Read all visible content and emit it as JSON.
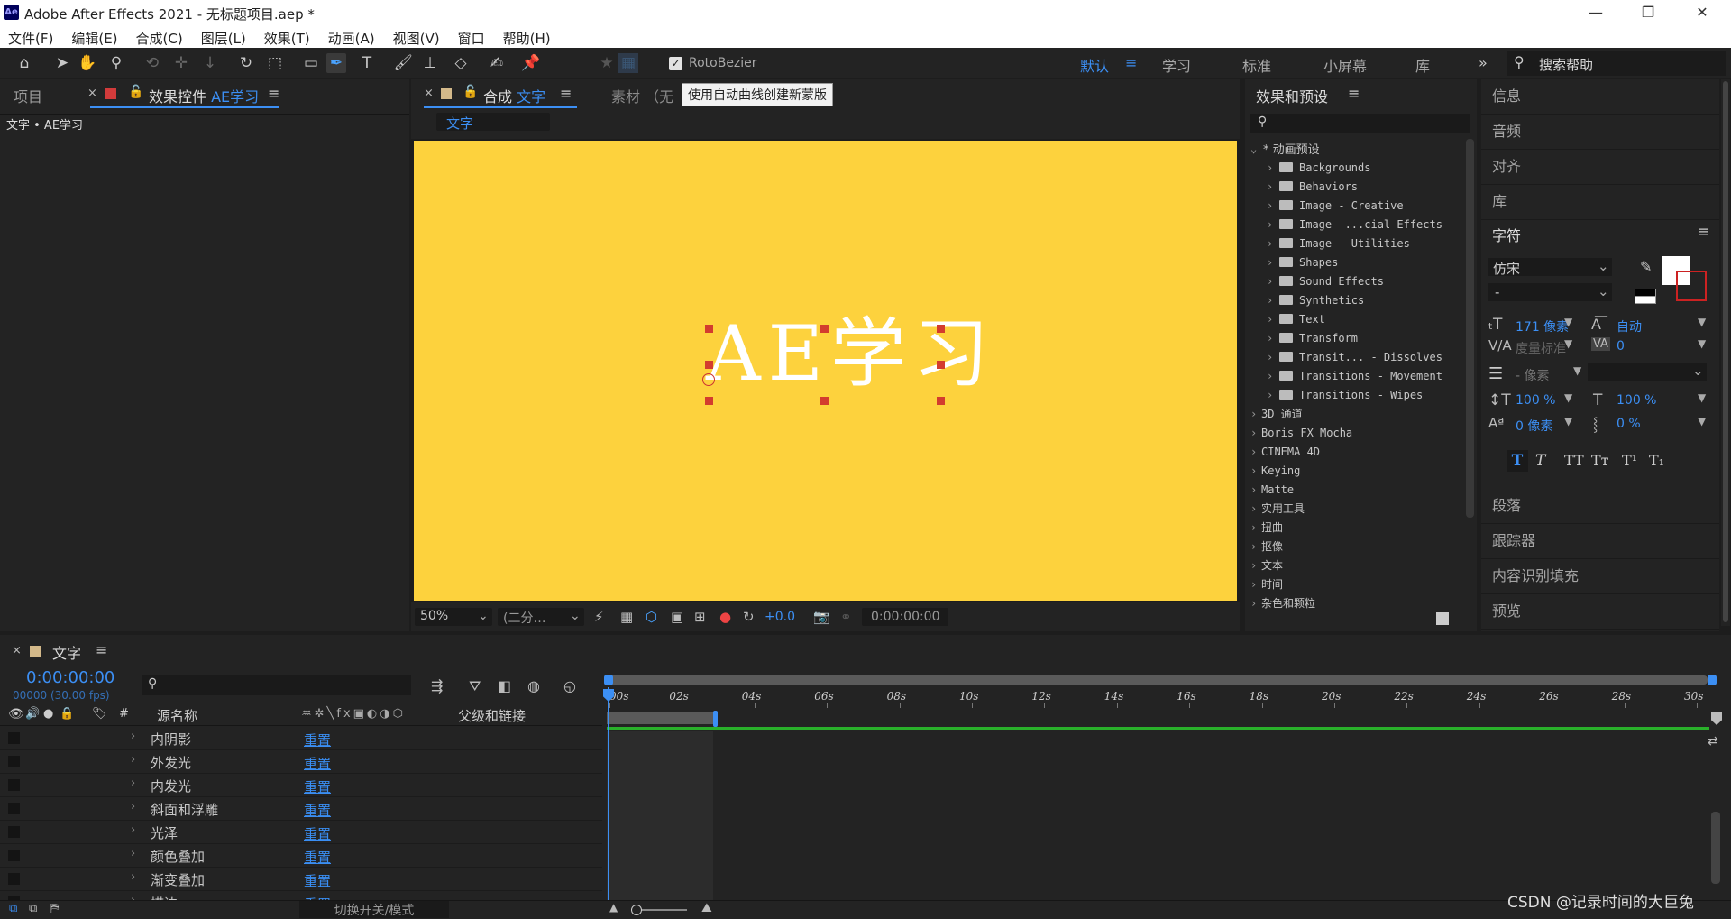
{
  "window": {
    "title": "Adobe After Effects 2021 - 无标题项目.aep *",
    "logo_text": "Ae"
  },
  "menu": [
    "文件(F)",
    "编辑(E)",
    "合成(C)",
    "图层(L)",
    "效果(T)",
    "动画(A)",
    "视图(V)",
    "窗口",
    "帮助(H)"
  ],
  "toolbar": {
    "rotobezier_label": "RotoBezier",
    "workspaces": [
      "默认",
      "学习",
      "标准",
      "小屏幕",
      "库"
    ],
    "search_placeholder": "搜索帮助"
  },
  "tooltip": "使用自动曲线创建新蒙版",
  "left_panel": {
    "tab_project": "项目",
    "tab_effects_prefix": "效果控件",
    "tab_effects_layer": "AE学习",
    "breadcrumb": "文字 • AE学习"
  },
  "comp_panel": {
    "tab_prefix": "合成",
    "tab_name": "文字",
    "footage_tab": "素材 （无",
    "subtab": "文字",
    "canvas_text": "AE学习",
    "canvas_bg": "#fdd23d",
    "zoom": "50%",
    "resolution": "(二分…",
    "exposure": "+0.0",
    "timecode": "0:00:00:00"
  },
  "effects_panel": {
    "title": "效果和预设",
    "presets_root": "* 动画预设",
    "preset_folders": [
      "Backgrounds",
      "Behaviors",
      "Image - Creative",
      "Image -...cial Effects",
      "Image - Utilities",
      "Shapes",
      "Sound Effects",
      "Synthetics",
      "Text",
      "Transform",
      "Transit... - Dissolves",
      "Transitions - Movement",
      "Transitions - Wipes"
    ],
    "categories": [
      "3D 通道",
      "Boris FX Mocha",
      "CINEMA 4D",
      "Keying",
      "Matte",
      "实用工具",
      "扭曲",
      "抠像",
      "文本",
      "时间",
      "杂色和颗粒"
    ]
  },
  "right_panel": {
    "items_top": [
      "信息",
      "音频",
      "对齐",
      "库"
    ],
    "character_title": "字符",
    "font_name": "仿宋",
    "font_style": "-",
    "font_size": "171 像素",
    "leading": "自动",
    "kerning": "度量标准",
    "tracking": "0",
    "stroke_width": "- 像素",
    "vscale": "100 %",
    "hscale": "100 %",
    "baseline": "0 像素",
    "tsume": "0 %",
    "items_bottom": [
      "段落",
      "跟踪器",
      "内容识别填充",
      "预览"
    ]
  },
  "timeline": {
    "tab_name": "文字",
    "timecode": "0:00:00:00",
    "frame_info": "00000 (30.00 fps)",
    "col_source": "源名称",
    "col_parent": "父级和链接",
    "col_number": "#",
    "rows": [
      {
        "name": "内阴影",
        "reset": "重置"
      },
      {
        "name": "外发光",
        "reset": "重置"
      },
      {
        "name": "内发光",
        "reset": "重置"
      },
      {
        "name": "斜面和浮雕",
        "reset": "重置"
      },
      {
        "name": "光泽",
        "reset": "重置"
      },
      {
        "name": "颜色叠加",
        "reset": "重置"
      },
      {
        "name": "渐变叠加",
        "reset": "重置"
      },
      {
        "name": "描边",
        "reset": "重置"
      }
    ],
    "ticks": [
      ":00s",
      "02s",
      "04s",
      "06s",
      "08s",
      "10s",
      "12s",
      "14s",
      "16s",
      "18s",
      "20s",
      "22s",
      "24s",
      "26s",
      "28s",
      "30s"
    ],
    "toggle_label": "切换开关/模式",
    "watermark": "CSDN @记录时间的大巨兔"
  }
}
